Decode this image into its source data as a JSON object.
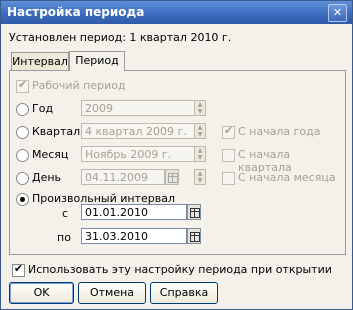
{
  "window": {
    "title": "Настройка периода",
    "close_glyph": "✕"
  },
  "status_text": "Установлен период: 1 квартал 2010 г.",
  "tabs": [
    {
      "label": "Интервал"
    },
    {
      "label": "Период"
    }
  ],
  "panel": {
    "workperiod": {
      "label": "Рабочий период",
      "checked": true,
      "enabled": false
    },
    "year": {
      "label": "Год",
      "value": "2009"
    },
    "quarter": {
      "label": "Квартал",
      "value": "4 квартал 2009 г."
    },
    "month": {
      "label": "Месяц",
      "value": "Ноябрь 2009 г."
    },
    "day": {
      "label": "День",
      "value": "04.11.2009"
    },
    "opt_from_year": {
      "label": "С начала года",
      "checked": true
    },
    "opt_from_quarter": {
      "label": "С начала квартала",
      "checked": false
    },
    "opt_from_month": {
      "label": "С начала месяца",
      "checked": false
    },
    "custom": {
      "label": "Произвольный интервал",
      "from_label": "с",
      "from_value": "01.01.2010",
      "to_label": "по",
      "to_value": "31.03.2010"
    }
  },
  "use_on_open": {
    "label": "Использовать эту настройку периода при открытии",
    "checked": true
  },
  "buttons": {
    "ok": "OK",
    "cancel": "Отмена",
    "help": "Справка"
  },
  "glyphs": {
    "check": "✔",
    "spin_up": "▲",
    "spin_down": "▼"
  }
}
